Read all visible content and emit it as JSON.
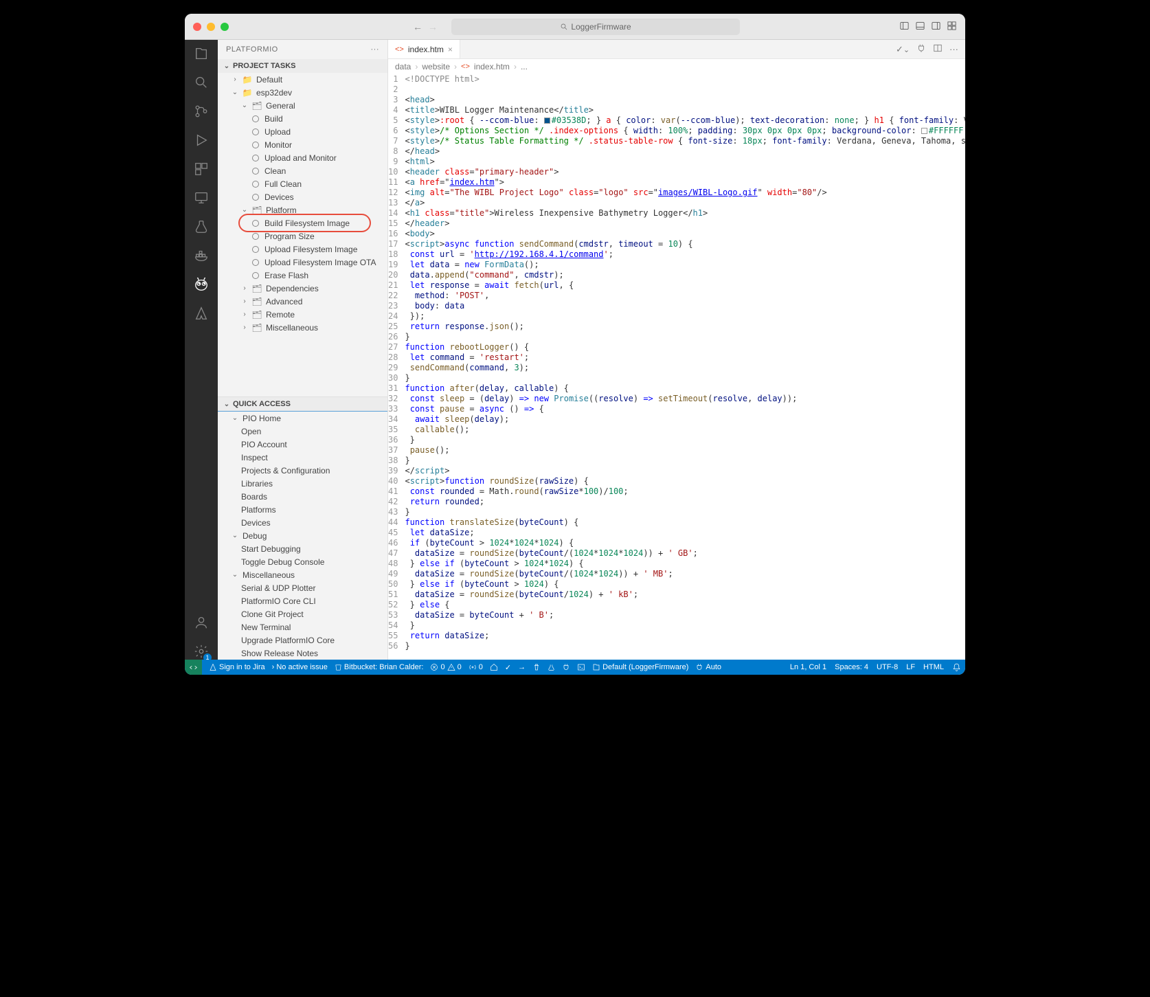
{
  "titlebar": {
    "search_placeholder": "LoggerFirmware"
  },
  "sidebar": {
    "panel_title": "PLATFORMIO",
    "sections": {
      "project_tasks": "PROJECT TASKS",
      "quick_access": "QUICK ACCESS"
    },
    "tree": {
      "default": "Default",
      "esp32dev": "esp32dev",
      "general": "General",
      "build": "Build",
      "upload": "Upload",
      "monitor": "Monitor",
      "upload_monitor": "Upload and Monitor",
      "clean": "Clean",
      "full_clean": "Full Clean",
      "devices": "Devices",
      "platform": "Platform",
      "build_fs": "Build Filesystem Image",
      "program_size": "Program Size",
      "upload_fs": "Upload Filesystem Image",
      "upload_fs_ota": "Upload Filesystem Image OTA",
      "erase_flash": "Erase Flash",
      "dependencies": "Dependencies",
      "advanced": "Advanced",
      "remote": "Remote",
      "miscellaneous": "Miscellaneous"
    },
    "quick": {
      "pio_home": "PIO Home",
      "open": "Open",
      "pio_account": "PIO Account",
      "inspect": "Inspect",
      "projects": "Projects & Configuration",
      "libraries": "Libraries",
      "boards": "Boards",
      "platforms": "Platforms",
      "devices": "Devices",
      "debug": "Debug",
      "start_debugging": "Start Debugging",
      "toggle_debug": "Toggle Debug Console",
      "misc": "Miscellaneous",
      "serial_udp": "Serial & UDP Plotter",
      "pio_cli": "PlatformIO Core CLI",
      "clone_git": "Clone Git Project",
      "new_terminal": "New Terminal",
      "upgrade": "Upgrade PlatformIO Core",
      "release_notes": "Show Release Notes"
    }
  },
  "tabs": {
    "active": "index.htm"
  },
  "breadcrumbs": {
    "p0": "data",
    "p1": "website",
    "p2": "index.htm",
    "p3": "..."
  },
  "code": {
    "total_lines": 56,
    "l1": "<!DOCTYPE html>",
    "l3": "<head>",
    "l4_title": "WIBL Logger Maintenance",
    "l5_hex": "#03538D",
    "l6_comment": "/* Options Section */",
    "l6_sel": ".index-options",
    "l6_width": "100%",
    "l6_padding": "30px 0px 0px 0px",
    "l6_bg_hex": "#FFFFFF",
    "l7_comment": "/* Status Table Formatting */",
    "l7_sel": ".status-table-row",
    "l7_fs": "18px",
    "l7_ff": "Verdana, Geneva, Tahoma, sans-serif",
    "l8": "</head>",
    "l9": "<html>",
    "l10_cls": "primary-header",
    "l11_href": "index.htm",
    "l12_alt": "The WIBL Project Logo",
    "l12_cls": "logo",
    "l12_src": "images/WIBL-Logo.gif",
    "l12_w": "80",
    "l14_cls": "title",
    "l14_txt": "Wireless Inexpensive Bathymetry Logger",
    "l17_fn": "sendCommand",
    "l17_p1": "cmdstr",
    "l17_p2": "timeout",
    "l17_def": "10",
    "l18_url": "http://192.168.4.1/command",
    "l19_fd": "FormData",
    "l20_key": "command",
    "l22_method": "POST",
    "l27_fn": "rebootLogger",
    "l28_cmd": "restart",
    "l29_n": "3",
    "l31_fn": "after",
    "l31_p1": "delay",
    "l31_p2": "callable",
    "l40_fn": "roundSize",
    "l40_p": "rawSize",
    "l41_n1": "100",
    "l41_n2": "100",
    "l44_fn": "translateSize",
    "l44_p": "byteCount",
    "l46_n1": "1024",
    "l47_suf": "' GB'",
    "l49_suf": "' MB'",
    "l51_suf": "' kB'",
    "l53_suf": "' B'"
  },
  "statusbar": {
    "jira": "Sign in to Jira",
    "no_issue": "No active issue",
    "bitbucket": "Bitbucket: Brian Calder:",
    "errors": "0",
    "warnings": "0",
    "radio": "0",
    "default_env": "Default (LoggerFirmware)",
    "auto": "Auto",
    "pos": "Ln 1, Col 1",
    "spaces": "Spaces: 4",
    "enc": "UTF-8",
    "eol": "LF",
    "lang": "HTML"
  }
}
